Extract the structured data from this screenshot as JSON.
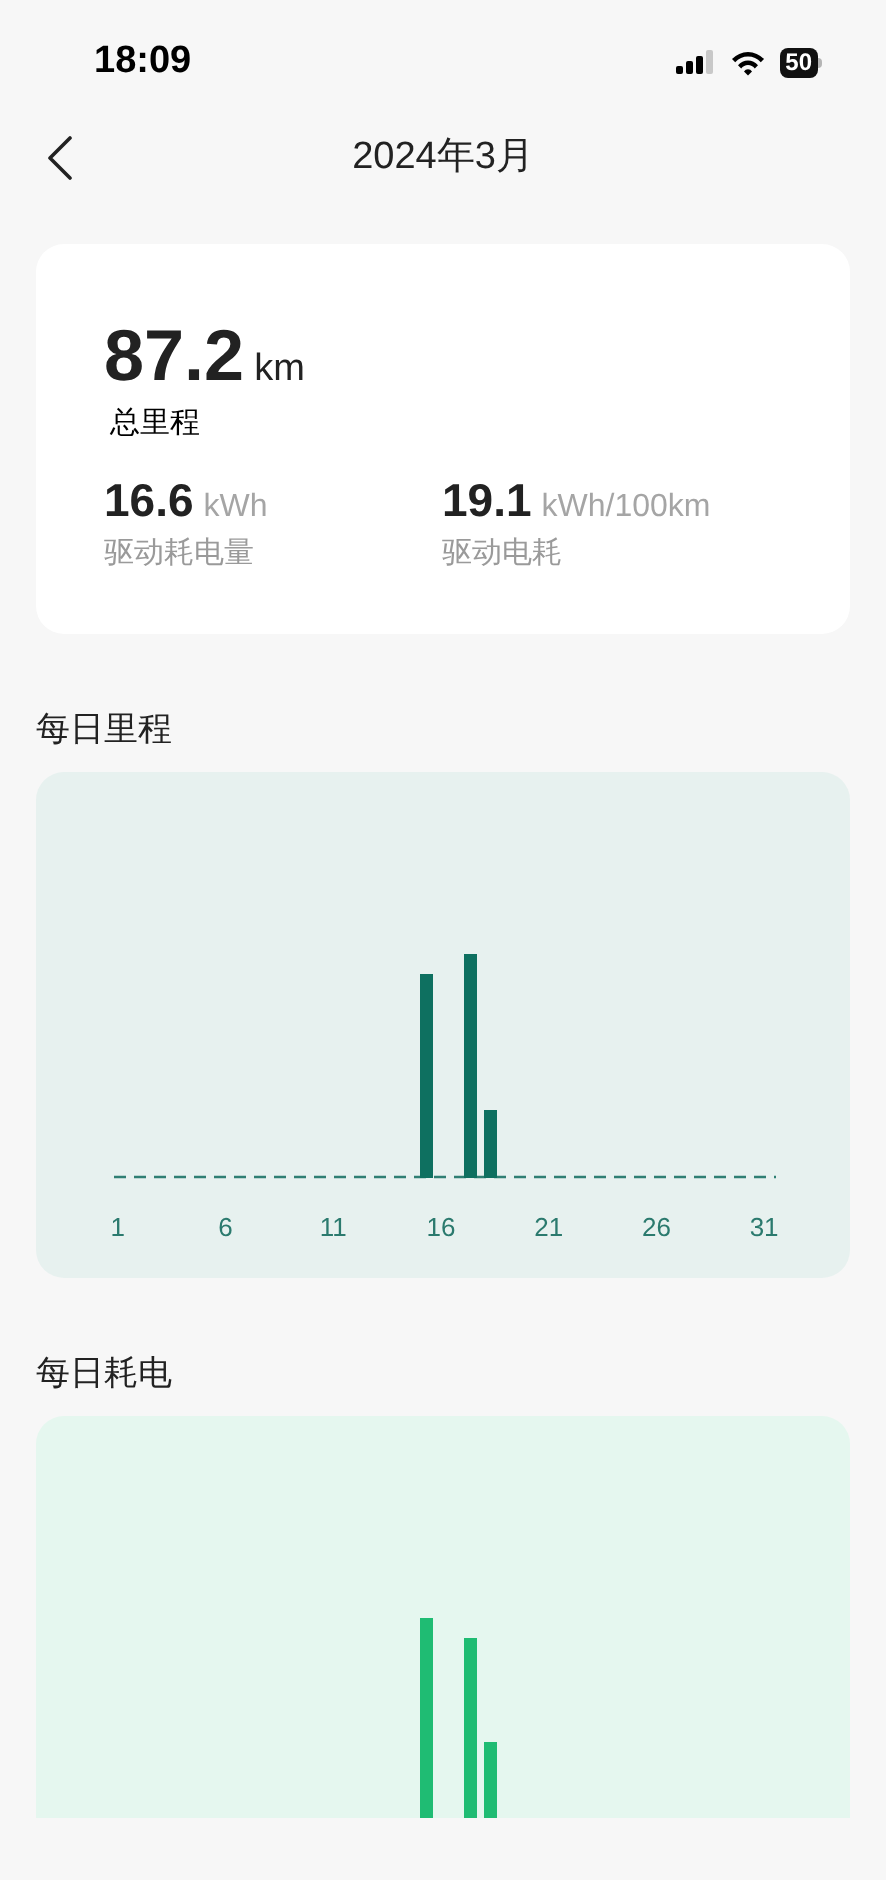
{
  "status_bar": {
    "time": "18:09",
    "battery": "50"
  },
  "nav": {
    "title": "2024年3月"
  },
  "summary": {
    "total": {
      "value": "87.2",
      "unit": "km",
      "label": "总里程"
    },
    "stats": [
      {
        "value": "16.6",
        "unit": "kWh",
        "label": "驱动耗电量"
      },
      {
        "value": "19.1",
        "unit": "kWh/100km",
        "label": "驱动电耗"
      }
    ]
  },
  "sections": [
    {
      "title": "每日里程",
      "kind": "mileage",
      "x_labels": [
        "1",
        "6",
        "11",
        "16",
        "21",
        "26",
        "31"
      ]
    },
    {
      "title": "每日耗电",
      "kind": "energy"
    }
  ]
}
